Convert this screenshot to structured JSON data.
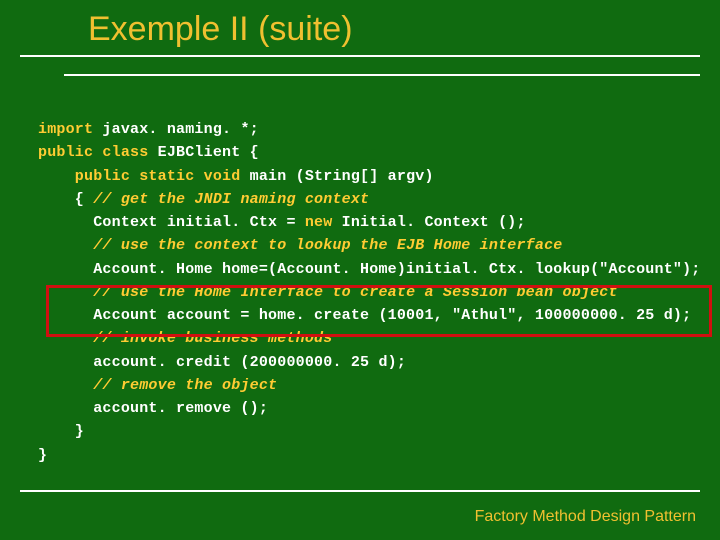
{
  "title": "Exemple II (suite)",
  "footer": "Factory Method Design Pattern",
  "code": {
    "l1a": "import",
    "l1b": " javax. naming. *;",
    "l2a": "public class",
    "l2b": " EJBClient {",
    "l3a": "    public static void",
    "l3b": " main (String[] argv)",
    "l4a": "    { ",
    "l4b": "// get the JNDI naming context",
    "l5": "      Context initial. Ctx = ",
    "l5a": "new",
    "l5b": " Initial. Context ();",
    "l6": "      ",
    "l6b": "// use the context to lookup the EJB Home interface",
    "l7": "      Account. Home home=(Account. Home)initial. Ctx. lookup(\"Account\");",
    "l8": "      ",
    "l8b": "// use the Home Interface to create a Session bean object",
    "l9": "      Account account = home. create (10001, \"Athul\", 100000000. 25 d);",
    "l10": "      ",
    "l10b": "// invoke business methods",
    "l11": "      account. credit (200000000. 25 d);",
    "l12": "      ",
    "l12b": "// remove the object",
    "l13": "      account. remove ();",
    "l14": "    }",
    "l15": "}"
  }
}
